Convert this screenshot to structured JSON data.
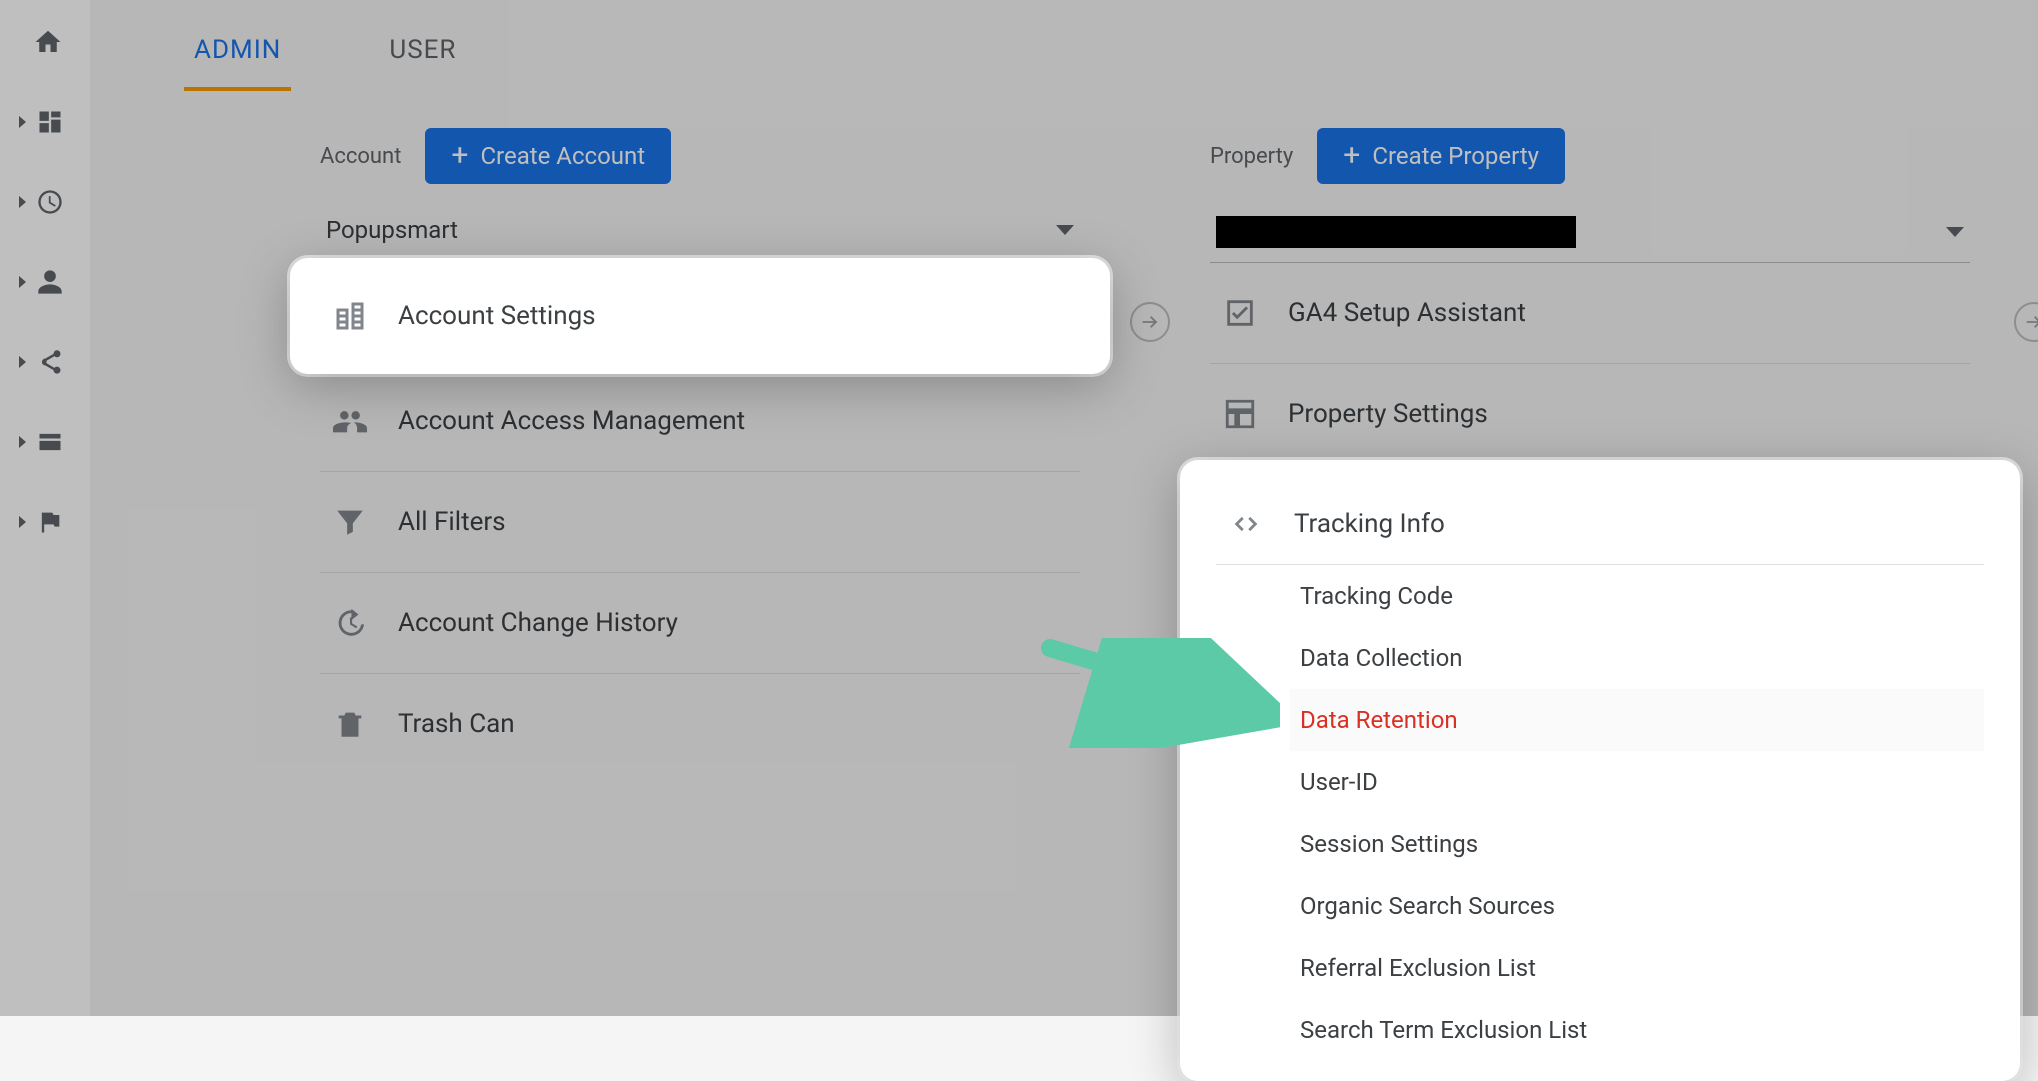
{
  "tabs": {
    "admin": "ADMIN",
    "user": "USER"
  },
  "account": {
    "label": "Account",
    "create_btn": "Create Account",
    "selected": "Popupsmart",
    "items": {
      "settings": "Account Settings",
      "access": "Account Access Management",
      "filters": "All Filters",
      "history": "Account Change History",
      "trash": "Trash Can"
    }
  },
  "property": {
    "label": "Property",
    "create_btn": "Create Property",
    "items": {
      "ga4": "GA4 Setup Assistant",
      "settings": "Property Settings",
      "tracking_info": "Tracking Info"
    },
    "tracking_sub": {
      "code": "Tracking Code",
      "collection": "Data Collection",
      "retention": "Data Retention",
      "userid": "User-ID",
      "session": "Session Settings",
      "organic": "Organic Search Sources",
      "referral": "Referral Exclusion List",
      "searchterm": "Search Term Exclusion List"
    }
  },
  "colors": {
    "primary": "#1a73e8",
    "accent": "#f89b00",
    "danger": "#d93025",
    "annotation": "#5cc9a7"
  }
}
